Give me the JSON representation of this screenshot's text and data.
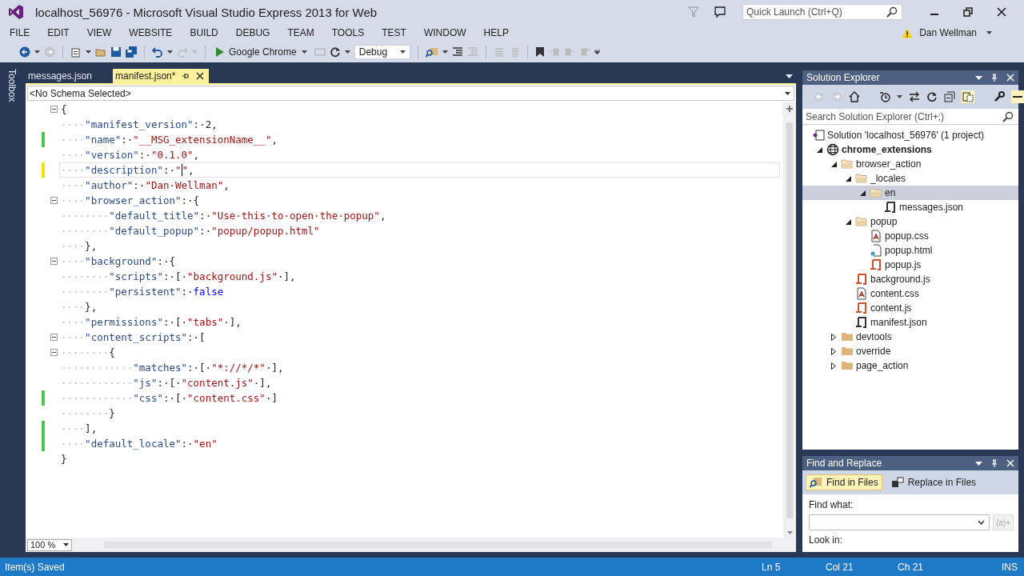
{
  "window": {
    "title": "localhost_56976 - Microsoft Visual Studio Express 2013 for Web",
    "quick_launch_placeholder": "Quick Launch (Ctrl+Q)"
  },
  "menu": [
    "FILE",
    "EDIT",
    "VIEW",
    "WEBSITE",
    "BUILD",
    "DEBUG",
    "TEAM",
    "TOOLS",
    "TEST",
    "WINDOW",
    "HELP"
  ],
  "user": {
    "name": "Dan Wellman"
  },
  "toolbar": {
    "run_target": "Google Chrome",
    "configuration": "Debug"
  },
  "toolbox_label": "Toolbox",
  "tabs": [
    {
      "label": "messages.json",
      "selected": false
    },
    {
      "label": "manifest.json*",
      "selected": true
    }
  ],
  "editor": {
    "schema": "<No Schema Selected>",
    "zoom": "100 %",
    "lines": [
      {
        "fold": true,
        "modified": false,
        "unsaved": false,
        "current": false,
        "tokens": [
          {
            "kind": "punct",
            "text": "{"
          }
        ]
      },
      {
        "fold": false,
        "modified": false,
        "unsaved": false,
        "current": false,
        "tokens": [
          {
            "kind": "space",
            "text": "····"
          },
          {
            "kind": "key",
            "text": "\"manifest_version\""
          },
          {
            "kind": "punct",
            "text": ":·"
          },
          {
            "kind": "number",
            "text": "2"
          },
          {
            "kind": "punct",
            "text": ","
          }
        ]
      },
      {
        "fold": false,
        "modified": true,
        "unsaved": false,
        "current": false,
        "tokens": [
          {
            "kind": "space",
            "text": "····"
          },
          {
            "kind": "key",
            "text": "\"name\""
          },
          {
            "kind": "punct",
            "text": ":·"
          },
          {
            "kind": "string",
            "text": "\"__MSG_extensionName__\""
          },
          {
            "kind": "punct",
            "text": ","
          }
        ]
      },
      {
        "fold": false,
        "modified": false,
        "unsaved": false,
        "current": false,
        "tokens": [
          {
            "kind": "space",
            "text": "····"
          },
          {
            "kind": "key",
            "text": "\"version\""
          },
          {
            "kind": "punct",
            "text": ":·"
          },
          {
            "kind": "string",
            "text": "\"0.1.0\""
          },
          {
            "kind": "punct",
            "text": ","
          }
        ]
      },
      {
        "fold": false,
        "modified": true,
        "unsaved": true,
        "current": true,
        "tokens": [
          {
            "kind": "space",
            "text": "····"
          },
          {
            "kind": "key",
            "text": "\"description\""
          },
          {
            "kind": "punct",
            "text": ":·"
          },
          {
            "kind": "string",
            "text": "\""
          },
          {
            "kind": "caret"
          },
          {
            "kind": "string",
            "text": "\""
          },
          {
            "kind": "punct",
            "text": ","
          }
        ]
      },
      {
        "fold": false,
        "modified": false,
        "unsaved": false,
        "current": false,
        "tokens": [
          {
            "kind": "space",
            "text": "····"
          },
          {
            "kind": "key",
            "text": "\"author\""
          },
          {
            "kind": "punct",
            "text": ":·"
          },
          {
            "kind": "string",
            "text": "\"Dan·Wellman\""
          },
          {
            "kind": "punct",
            "text": ","
          }
        ]
      },
      {
        "fold": true,
        "modified": false,
        "unsaved": false,
        "current": false,
        "tokens": [
          {
            "kind": "space",
            "text": "····"
          },
          {
            "kind": "key",
            "text": "\"browser_action\""
          },
          {
            "kind": "punct",
            "text": ":·{"
          }
        ]
      },
      {
        "fold": false,
        "modified": false,
        "unsaved": false,
        "current": false,
        "tokens": [
          {
            "kind": "space",
            "text": "········"
          },
          {
            "kind": "key",
            "text": "\"default_title\""
          },
          {
            "kind": "punct",
            "text": ":·"
          },
          {
            "kind": "string",
            "text": "\"Use·this·to·open·the·popup\""
          },
          {
            "kind": "punct",
            "text": ","
          }
        ]
      },
      {
        "fold": false,
        "modified": false,
        "unsaved": false,
        "current": false,
        "tokens": [
          {
            "kind": "space",
            "text": "········"
          },
          {
            "kind": "key",
            "text": "\"default_popup\""
          },
          {
            "kind": "punct",
            "text": ":·"
          },
          {
            "kind": "string",
            "text": "\"popup/popup.html\""
          }
        ]
      },
      {
        "fold": false,
        "modified": false,
        "unsaved": false,
        "current": false,
        "tokens": [
          {
            "kind": "space",
            "text": "····"
          },
          {
            "kind": "punct",
            "text": "},"
          }
        ]
      },
      {
        "fold": true,
        "modified": false,
        "unsaved": false,
        "current": false,
        "tokens": [
          {
            "kind": "space",
            "text": "····"
          },
          {
            "kind": "key",
            "text": "\"background\""
          },
          {
            "kind": "punct",
            "text": ":·{"
          }
        ]
      },
      {
        "fold": false,
        "modified": false,
        "unsaved": false,
        "current": false,
        "tokens": [
          {
            "kind": "space",
            "text": "········"
          },
          {
            "kind": "key",
            "text": "\"scripts\""
          },
          {
            "kind": "punct",
            "text": ":·[·"
          },
          {
            "kind": "string",
            "text": "\"background.js\""
          },
          {
            "kind": "punct",
            "text": "·],"
          }
        ]
      },
      {
        "fold": false,
        "modified": false,
        "unsaved": false,
        "current": false,
        "tokens": [
          {
            "kind": "space",
            "text": "········"
          },
          {
            "kind": "key",
            "text": "\"persistent\""
          },
          {
            "kind": "punct",
            "text": ":·"
          },
          {
            "kind": "literal",
            "text": "false"
          }
        ]
      },
      {
        "fold": false,
        "modified": false,
        "unsaved": false,
        "current": false,
        "tokens": [
          {
            "kind": "space",
            "text": "····"
          },
          {
            "kind": "punct",
            "text": "},"
          }
        ]
      },
      {
        "fold": false,
        "modified": false,
        "unsaved": false,
        "current": false,
        "tokens": [
          {
            "kind": "space",
            "text": "····"
          },
          {
            "kind": "key",
            "text": "\"permissions\""
          },
          {
            "kind": "punct",
            "text": ":·[·"
          },
          {
            "kind": "string",
            "text": "\"tabs\""
          },
          {
            "kind": "punct",
            "text": "·],"
          }
        ]
      },
      {
        "fold": true,
        "modified": false,
        "unsaved": false,
        "current": false,
        "tokens": [
          {
            "kind": "space",
            "text": "····"
          },
          {
            "kind": "key",
            "text": "\"content_scripts\""
          },
          {
            "kind": "punct",
            "text": ":·["
          }
        ]
      },
      {
        "fold": true,
        "modified": false,
        "unsaved": false,
        "current": false,
        "tokens": [
          {
            "kind": "space",
            "text": "········"
          },
          {
            "kind": "punct",
            "text": "{"
          }
        ]
      },
      {
        "fold": false,
        "modified": false,
        "unsaved": false,
        "current": false,
        "tokens": [
          {
            "kind": "space",
            "text": "············"
          },
          {
            "kind": "key",
            "text": "\"matches\""
          },
          {
            "kind": "punct",
            "text": ":·[·"
          },
          {
            "kind": "string",
            "text": "\"*://*/*\""
          },
          {
            "kind": "punct",
            "text": "·],"
          }
        ]
      },
      {
        "fold": false,
        "modified": false,
        "unsaved": false,
        "current": false,
        "tokens": [
          {
            "kind": "space",
            "text": "············"
          },
          {
            "kind": "key",
            "text": "\"js\""
          },
          {
            "kind": "punct",
            "text": ":·[·"
          },
          {
            "kind": "string",
            "text": "\"content.js\""
          },
          {
            "kind": "punct",
            "text": "·],"
          }
        ]
      },
      {
        "fold": false,
        "modified": true,
        "unsaved": false,
        "current": false,
        "tokens": [
          {
            "kind": "space",
            "text": "············"
          },
          {
            "kind": "key",
            "text": "\"css\""
          },
          {
            "kind": "punct",
            "text": ":·[·"
          },
          {
            "kind": "string",
            "text": "\"content.css\""
          },
          {
            "kind": "punct",
            "text": "·]"
          }
        ]
      },
      {
        "fold": false,
        "modified": false,
        "unsaved": false,
        "current": false,
        "tokens": [
          {
            "kind": "space",
            "text": "········"
          },
          {
            "kind": "punct",
            "text": "}"
          }
        ]
      },
      {
        "fold": false,
        "modified": true,
        "unsaved": false,
        "current": false,
        "tokens": [
          {
            "kind": "space",
            "text": "····"
          },
          {
            "kind": "punct",
            "text": "],"
          }
        ]
      },
      {
        "fold": false,
        "modified": true,
        "unsaved": false,
        "current": false,
        "tokens": [
          {
            "kind": "space",
            "text": "····"
          },
          {
            "kind": "key",
            "text": "\"default_locale\""
          },
          {
            "kind": "punct",
            "text": ":·"
          },
          {
            "kind": "string",
            "text": "\"en\""
          }
        ]
      },
      {
        "fold": false,
        "modified": false,
        "unsaved": false,
        "current": false,
        "tokens": [
          {
            "kind": "punct",
            "text": "}"
          }
        ]
      }
    ]
  },
  "solution_explorer": {
    "title": "Solution Explorer",
    "search_placeholder": "Search Solution Explorer (Ctrl+;)",
    "tree": [
      {
        "label": "Solution 'localhost_56976' (1 project)",
        "kind": "solution",
        "selected": false,
        "children": [
          {
            "label": "chrome_extensions",
            "kind": "project",
            "expanded": true,
            "selected": false,
            "children": [
              {
                "label": "browser_action",
                "kind": "folder",
                "expanded": true,
                "selected": false,
                "children": [
                  {
                    "label": "_locales",
                    "kind": "folder",
                    "expanded": true,
                    "selected": false,
                    "children": [
                      {
                        "label": "en",
                        "kind": "folder",
                        "expanded": true,
                        "selected": true,
                        "children": [
                          {
                            "label": "messages.json",
                            "kind": "json",
                            "selected": false
                          }
                        ]
                      }
                    ]
                  },
                  {
                    "label": "popup",
                    "kind": "folder",
                    "expanded": true,
                    "selected": false,
                    "children": [
                      {
                        "label": "popup.css",
                        "kind": "css",
                        "selected": false
                      },
                      {
                        "label": "popup.html",
                        "kind": "html",
                        "selected": false
                      },
                      {
                        "label": "popup.js",
                        "kind": "js",
                        "selected": false
                      }
                    ]
                  },
                  {
                    "label": "background.js",
                    "kind": "js",
                    "selected": false
                  },
                  {
                    "label": "content.css",
                    "kind": "css",
                    "selected": false
                  },
                  {
                    "label": "content.js",
                    "kind": "js",
                    "selected": false
                  },
                  {
                    "label": "manifest.json",
                    "kind": "json",
                    "selected": false
                  }
                ]
              },
              {
                "label": "devtools",
                "kind": "folder",
                "expanded": false,
                "selected": false
              },
              {
                "label": "override",
                "kind": "folder",
                "expanded": false,
                "selected": false
              },
              {
                "label": "page_action",
                "kind": "folder",
                "expanded": false,
                "selected": false
              }
            ]
          }
        ]
      }
    ]
  },
  "find_replace": {
    "title": "Find and Replace",
    "tabs": [
      {
        "label": "Find in Files",
        "selected": true
      },
      {
        "label": "Replace in Files",
        "selected": false
      }
    ],
    "find_label": "Find what:",
    "regex_button": "(a)+",
    "look_in_label": "Look in:"
  },
  "status_bar": {
    "message": "Item(s) Saved",
    "line": "Ln 5",
    "column": "Col 21",
    "char": "Ch 21",
    "mode": "INS"
  }
}
